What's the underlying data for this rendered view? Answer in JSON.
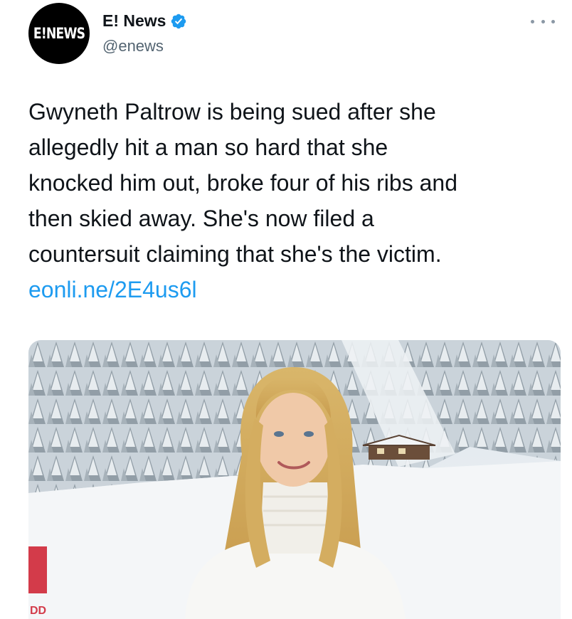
{
  "account": {
    "avatar_text": "E!NEWS",
    "display_name": "E! News",
    "handle": "@enews",
    "verified": true
  },
  "tweet": {
    "lines": [
      "Gwyneth Paltrow is being sued after she",
      "allegedly hit a man so hard that she",
      "knocked him out, broke four of his ribs and",
      "then skied away. She's now filed a",
      "countersuit claiming that she's the victim."
    ],
    "link": "eonli.ne/2E4us6l"
  },
  "media": {
    "banner_text": "DD"
  },
  "colors": {
    "link": "#1d9bf0",
    "verified": "#1d9bf0",
    "secondary_text": "#536471"
  },
  "icons": {
    "verified": "verified-badge-icon",
    "more": "more-options-icon"
  }
}
